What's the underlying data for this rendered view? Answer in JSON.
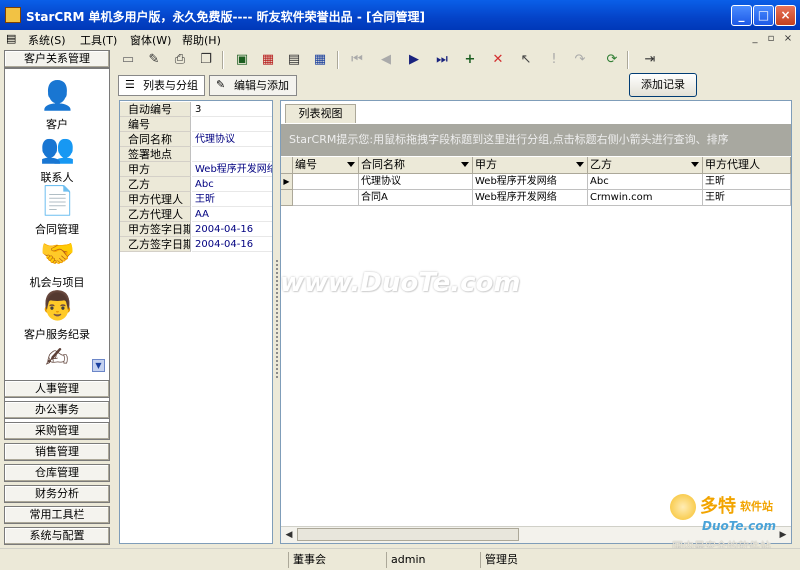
{
  "window": {
    "title": "StarCRM 单机多用户版，永久免费版---- 昕友软件荣誉出品  - [合同管理]",
    "minimize": "_",
    "maximize": "□",
    "close": "×"
  },
  "menu": {
    "items": [
      "系统(S)",
      "工具(T)",
      "窗体(W)",
      "帮助(H)"
    ],
    "mdi_controls": [
      "_",
      "▫",
      "×"
    ]
  },
  "toolbar": {
    "icons": [
      "open-icon",
      "edit-icon",
      "print-icon",
      "copy-icon",
      "window-icon",
      "report-icon",
      "table-icon",
      "grid-icon",
      "first-icon",
      "prev-icon",
      "next-icon",
      "last-icon",
      "add-icon",
      "delete-icon",
      "pointer-icon",
      "alert-icon",
      "undo-icon",
      "refresh-icon",
      "exit-icon"
    ]
  },
  "sidebar": {
    "top_group": "客户关系管理",
    "nav_items": [
      {
        "label": "客户",
        "icon": "search-person-icon"
      },
      {
        "label": "联系人",
        "icon": "contact-icon"
      },
      {
        "label": "合同管理",
        "icon": "contract-icon"
      },
      {
        "label": "机会与项目",
        "icon": "opportunity-icon"
      },
      {
        "label": "客户服务纪录",
        "icon": "service-icon"
      },
      {
        "label": "",
        "icon": "note-icon"
      }
    ],
    "groups": [
      "人事管理",
      "办公事务",
      "采购管理",
      "销售管理",
      "仓库管理",
      "财务分析",
      "常用工具栏",
      "系统与配置"
    ]
  },
  "tabs": {
    "list_group": "列表与分组",
    "edit_add": "编辑与添加",
    "add_record": "添加记录"
  },
  "detail": {
    "rows": [
      {
        "label": "自动编号",
        "value": "3"
      },
      {
        "label": "编号",
        "value": ""
      },
      {
        "label": "合同名称",
        "value": "代理协议"
      },
      {
        "label": "签署地点",
        "value": ""
      },
      {
        "label": "甲方",
        "value": "Web程序开发网络"
      },
      {
        "label": "乙方",
        "value": "Abc"
      },
      {
        "label": "甲方代理人",
        "value": "王昕"
      },
      {
        "label": "乙方代理人",
        "value": "AA"
      },
      {
        "label": "甲方签字日期",
        "value": "2004-04-16"
      },
      {
        "label": "乙方签字日期",
        "value": "2004-04-16"
      }
    ]
  },
  "grid": {
    "view_tab": "列表视图",
    "group_hint": "StarCRM提示您:用鼠标拖拽字段标题到这里进行分组,点击标题右侧小箭头进行查询、排序",
    "columns": [
      "编号",
      "合同名称",
      "甲方",
      "乙方",
      "甲方代理人"
    ],
    "rows": [
      [
        "",
        "代理协议",
        "Web程序开发网络",
        "Abc",
        "王昕"
      ],
      [
        "",
        "合同A",
        "Web程序开发网络",
        "Crmwin.com",
        "王昕"
      ]
    ],
    "current_row_marker": "▶"
  },
  "statusbar": {
    "cells": [
      "",
      "董事会",
      "admin",
      "管理员"
    ]
  },
  "watermark": {
    "text": "www.DuoTe.com",
    "logo_title": "多特",
    "logo_sub": "软件站",
    "logo_domain": "DuoTe.com",
    "logo_tagline": "国内最安全的软件站"
  }
}
